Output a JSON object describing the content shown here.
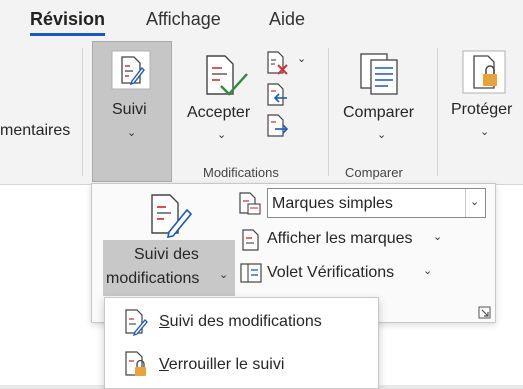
{
  "tabs": [
    {
      "label": "Révision",
      "active": true
    },
    {
      "label": "Affichage",
      "active": false
    },
    {
      "label": "Aide",
      "active": false
    }
  ],
  "ribbon": {
    "comments_partial": "mentaires",
    "suivi_label": "Suivi",
    "accepter_label": "Accepter",
    "modifications_group": "Modifications",
    "comparer_label": "Comparer",
    "comparer_group": "Comparer",
    "proteger_label": "Protéger"
  },
  "panel": {
    "suivi_des": "Suivi des",
    "modifications": "modifications",
    "marques_select": "Marques simples",
    "afficher_marques": "Afficher les marques",
    "volet_verifications": "Volet Vérifications"
  },
  "submenu": {
    "item1_u": "S",
    "item1_rest": "uivi des modifications",
    "item2_u": "V",
    "item2_rest": "errouiller le suivi"
  },
  "colors": {
    "accent": "#185abd",
    "red": "#d13438",
    "green": "#2e8b3e",
    "lock": "#e8a33d"
  }
}
